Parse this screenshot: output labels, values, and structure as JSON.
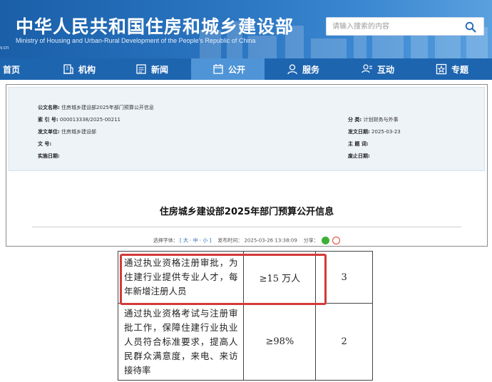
{
  "header": {
    "title": "中华人民共和国住房和城乡建设部",
    "subtitle": "Ministry of Housing and Urban-Rural Development of the People's Republic of China",
    "domain_fragment": "v.cn",
    "search": {
      "placeholder": "请输入搜索的内容",
      "icon": "search-icon"
    }
  },
  "nav": {
    "items": [
      {
        "label": "首页",
        "icon": ""
      },
      {
        "label": "机构",
        "icon": "building-icon"
      },
      {
        "label": "新闻",
        "icon": "news-icon"
      },
      {
        "label": "公开",
        "icon": "disclosure-icon",
        "active": true
      },
      {
        "label": "服务",
        "icon": "service-icon"
      },
      {
        "label": "互动",
        "icon": "interaction-icon"
      },
      {
        "label": "专题",
        "icon": "topic-icon"
      }
    ]
  },
  "meta": {
    "index_title_label": "公文名称:",
    "index_title_value": "住房城乡建设部2025年部门预算公开信息",
    "index_no_label": "索 引 号:",
    "index_no_value": "000013338/2025-00211",
    "issuer_label": "发文单位:",
    "issuer_value": "住房城乡建设部",
    "docno_label": "文    号:",
    "docno_value": "",
    "effective_label": "实施日期:",
    "effective_value": "",
    "category_label": "分    类:",
    "category_value": "计划财务与外事",
    "issue_date_label": "发文日期:",
    "issue_date_value": "2025-03-23",
    "subject_label": "主 题 词:",
    "subject_value": "",
    "expiry_label": "废止日期:",
    "expiry_value": ""
  },
  "document": {
    "title": "住房城乡建设部2025年部门预算公开信息",
    "font_size_label": "选择字体：",
    "font_size_options": "[ 大 · 中 · 小 ]",
    "publish_label": "发布时间：",
    "publish_time": "2025-03-26 13:38:09",
    "share_label": "分享：",
    "share_icons": [
      "wechat-icon",
      "weibo-icon"
    ]
  },
  "table": {
    "rows": [
      {
        "desc": "通过执业资格注册审批，为住建行业提供专业人才，每年新增注册人员",
        "value": "≥15 万人",
        "weight": "3",
        "highlighted": true
      },
      {
        "desc": "通过执业资格考试与注册审批工作，保障住建行业执业人员符合标准要求，提高人民群众满意度，来电、来访接待率",
        "value": "≥98%",
        "weight": "2",
        "highlighted": false
      }
    ]
  },
  "colors": {
    "banner": "#1a5fa8",
    "nav": "#1e65b0",
    "nav_active": "#4f94d6",
    "highlight": "#d23a3a"
  }
}
